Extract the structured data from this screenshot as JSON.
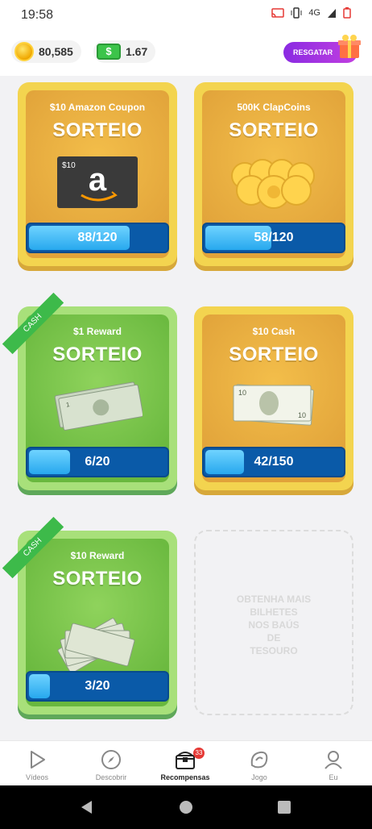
{
  "status": {
    "time": "19:58",
    "network": "4G"
  },
  "header": {
    "coins": "80,585",
    "cash": "1.67",
    "redeem_label": "RESGATAR"
  },
  "cards": [
    {
      "prize": "$10 Amazon Coupon",
      "action": "SORTEIO",
      "progress": "88/120",
      "progress_fraction": 0.733,
      "theme": "gold",
      "art": "amazon-gift-card",
      "card_value": "$10"
    },
    {
      "prize": "500K ClapCoins",
      "action": "SORTEIO",
      "progress": "58/120",
      "progress_fraction": 0.483,
      "theme": "gold",
      "art": "coin-pile"
    },
    {
      "prize": "$1 Reward",
      "action": "SORTEIO",
      "progress": "6/20",
      "progress_fraction": 0.3,
      "theme": "green",
      "art": "dollar-bills",
      "ribbon": "CASH"
    },
    {
      "prize": "$10 Cash",
      "action": "SORTEIO",
      "progress": "42/150",
      "progress_fraction": 0.28,
      "theme": "gold",
      "art": "ten-dollar-bill"
    },
    {
      "prize": "$10 Reward",
      "action": "SORTEIO",
      "progress": "3/20",
      "progress_fraction": 0.15,
      "theme": "green",
      "art": "bill-fan",
      "ribbon": "CASH"
    }
  ],
  "empty_slot": {
    "line1": "OBTENHA MAIS",
    "line2": "BILHETES",
    "line3": "NOS BAÚS",
    "line4": "DE",
    "line5": "TESOURO"
  },
  "nav": [
    {
      "label": "Vídeos",
      "icon": "play-icon"
    },
    {
      "label": "Descobrir",
      "icon": "compass-icon"
    },
    {
      "label": "Recompensas",
      "icon": "treasure-chest-icon",
      "badge": "33",
      "active": true
    },
    {
      "label": "Jogo",
      "icon": "game-icon"
    },
    {
      "label": "Eu",
      "icon": "profile-icon"
    }
  ]
}
